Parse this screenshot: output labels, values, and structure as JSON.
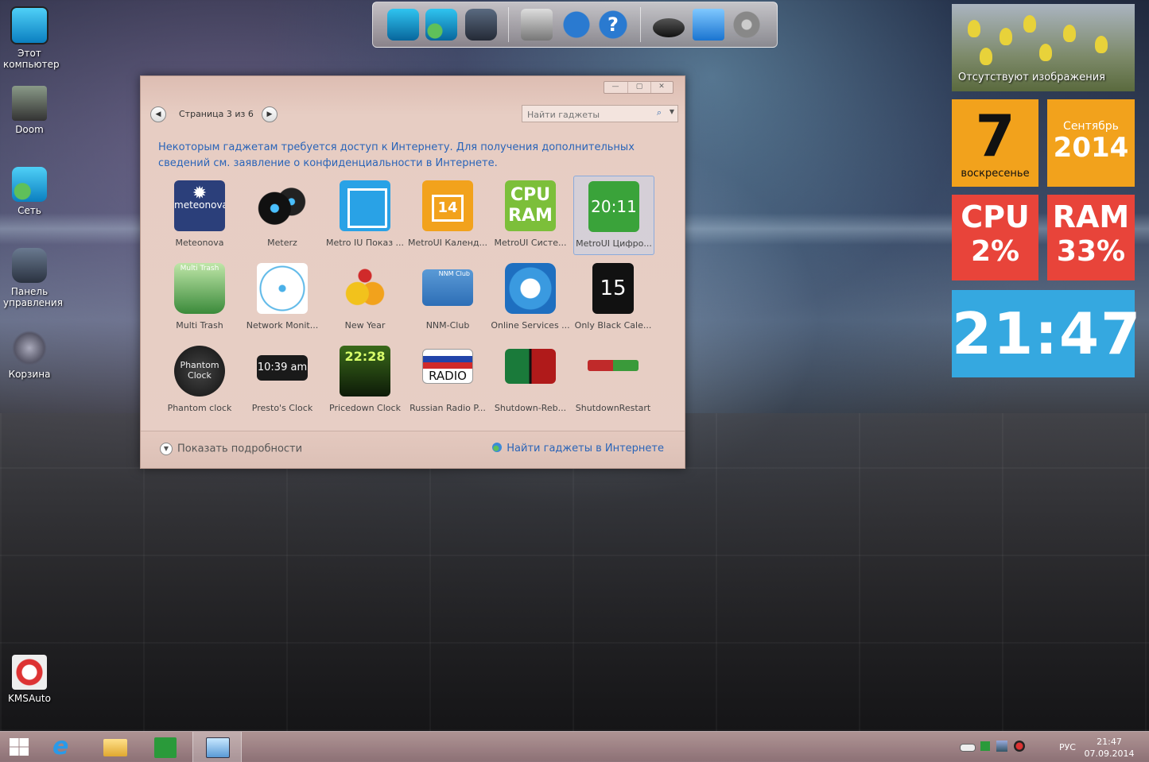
{
  "desktop_icons": [
    {
      "label": "Этот компьютер",
      "icon": "computer-icon"
    },
    {
      "label": "Doom",
      "icon": "doom-icon"
    },
    {
      "label": "Сеть",
      "icon": "network-icon"
    },
    {
      "label": "Панель управления",
      "icon": "control-panel-icon"
    },
    {
      "label": "Корзина",
      "icon": "recycle-bin-icon"
    },
    {
      "label": "KMSAuto",
      "icon": "kmsauto-icon"
    }
  ],
  "gadget_window": {
    "page_label": "Страница 3 из 6",
    "prev_glyph": "◀",
    "next_glyph": "▶",
    "search_placeholder": "Найти гаджеты",
    "notice": "Некоторым гаджетам требуется доступ к Интернету. Для получения дополнительных сведений см. заявление о конфиденциальности в Интернете.",
    "gadgets": [
      {
        "caption": "Meteonova",
        "icon_text": "meteonova"
      },
      {
        "caption": "Meterz",
        "icon_text": ""
      },
      {
        "caption": "Metro IU Показ ...",
        "icon_text": ""
      },
      {
        "caption": "MetroUI Календ...",
        "icon_text": "14"
      },
      {
        "caption": "MetroUI Систе...",
        "icon_text": "CPU RAM"
      },
      {
        "caption": "MetroUI Цифро...",
        "icon_text": "20:11"
      },
      {
        "caption": "Multi Trash",
        "icon_text": "Multi Trash"
      },
      {
        "caption": "Network Monit...",
        "icon_text": ""
      },
      {
        "caption": "New Year",
        "icon_text": ""
      },
      {
        "caption": "NNM-Club",
        "icon_text": "NNM Club"
      },
      {
        "caption": "Online Services ...",
        "icon_text": ""
      },
      {
        "caption": "Only Black Cale...",
        "icon_text": "15"
      },
      {
        "caption": "Phantom clock",
        "icon_text": "Phantom Clock"
      },
      {
        "caption": "Presto's Clock",
        "icon_text": "10:39 am"
      },
      {
        "caption": "Pricedown Clock",
        "icon_text": "22:28"
      },
      {
        "caption": "Russian Radio P...",
        "icon_text": "RADIO"
      },
      {
        "caption": "Shutdown-Reb...",
        "icon_text": ""
      },
      {
        "caption": "ShutdownRestart",
        "icon_text": ""
      }
    ],
    "show_details": "Показать подробности",
    "find_online": "Найти гаджеты в Интернете"
  },
  "right_gadgets": {
    "photo_text": "Отсутствуют изображения",
    "day_number": "7",
    "weekday": "воскресенье",
    "month": "Сентябрь",
    "year": "2014",
    "cpu_label": "CPU",
    "cpu_value": "2%",
    "ram_label": "RAM",
    "ram_value": "33%",
    "clock": "21:47"
  },
  "taskbar": {
    "lang": "РУС",
    "time": "21:47",
    "date": "07.09.2014"
  },
  "colors": {
    "tile_orange": "#f2a21c",
    "tile_red": "#e8443a",
    "tile_blue": "#35a8e0",
    "link_blue": "#2a64b8"
  }
}
